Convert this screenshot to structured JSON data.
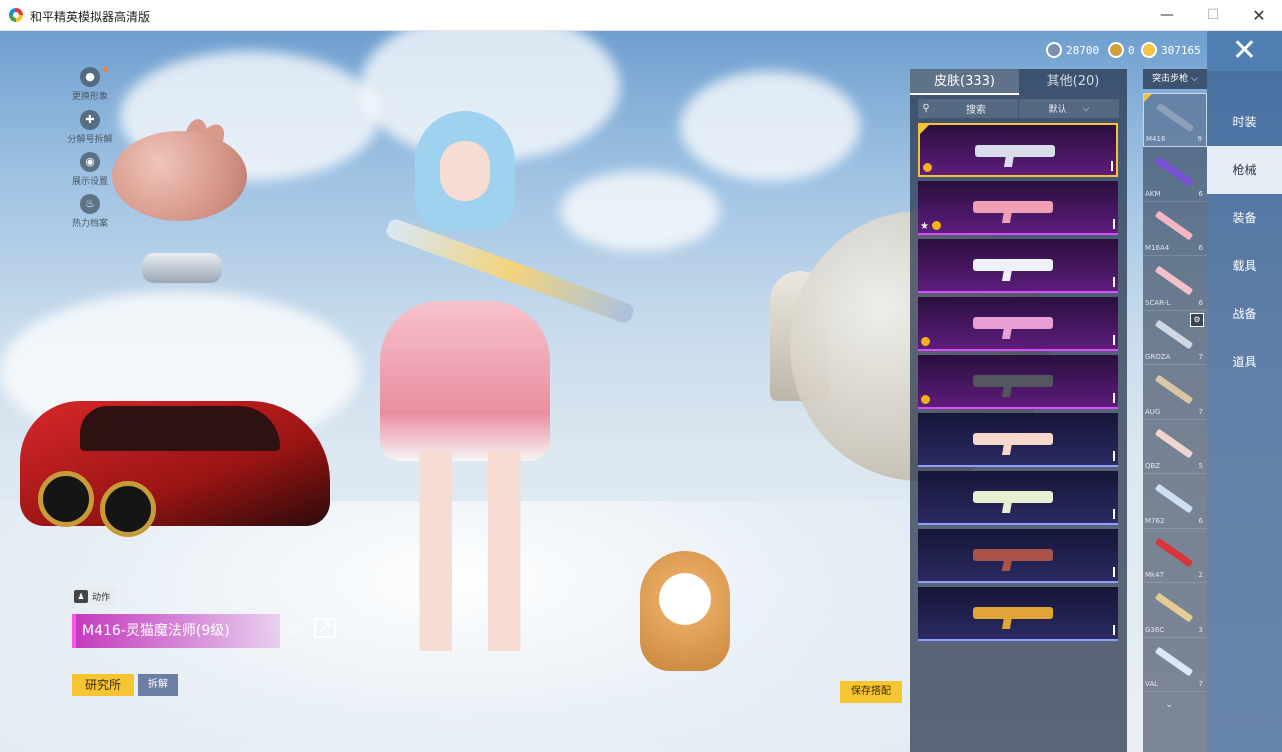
{
  "window": {
    "title": "和平精英模拟器高清版",
    "minimize": "—",
    "maximize": "☐",
    "close": "✕"
  },
  "currencies": [
    {
      "name": "coupon-icon",
      "value": "28700",
      "color": "#7c8fb0"
    },
    {
      "name": "token-icon",
      "value": "0",
      "color": "#d1a23a"
    },
    {
      "name": "gold-coin-icon",
      "value": "307165",
      "color": "#f2c54a"
    }
  ],
  "close_button": "✕",
  "left_menu": [
    {
      "icon": "avatar-icon",
      "label": "更换形象",
      "has_dot": true
    },
    {
      "icon": "share-puzzle-icon",
      "label": "分解号拆解",
      "has_dot": false
    },
    {
      "icon": "eye-icon",
      "label": "展示设置",
      "has_dot": false
    },
    {
      "icon": "flame-icon",
      "label": "热力档案",
      "has_dot": false
    }
  ],
  "weapon_info": {
    "action_label": "动作",
    "skin_name": "M416-灵猫魔法师(9级)",
    "research_button": "研究所",
    "disassemble_button": "拆解",
    "save_button": "保存搭配"
  },
  "skin_panel": {
    "tab_skin": "皮肤(333)",
    "tab_other": "其他(20)",
    "search_placeholder": "搜索",
    "sort_label": "默认",
    "cards": [
      {
        "style": "pink",
        "gun_color": "#d8dde9",
        "selected": true,
        "badge": "gold",
        "star": false
      },
      {
        "style": "pink",
        "gun_color": "#f19fb4",
        "selected": false,
        "badge": "gold",
        "star": true
      },
      {
        "style": "pink",
        "gun_color": "#eef2f8",
        "selected": false,
        "badge": "",
        "star": false
      },
      {
        "style": "pink",
        "gun_color": "#e79fd6",
        "selected": false,
        "badge": "gold",
        "star": false
      },
      {
        "style": "pink",
        "gun_color": "#55575e",
        "selected": false,
        "badge": "gold",
        "star": false
      },
      {
        "style": "blue",
        "gun_color": "#f5d8cb",
        "selected": false,
        "badge": "",
        "star": false
      },
      {
        "style": "blue",
        "gun_color": "#e8efd3",
        "selected": false,
        "badge": "",
        "star": false
      },
      {
        "style": "blue",
        "gun_color": "#a9534a",
        "selected": false,
        "badge": "",
        "star": false
      },
      {
        "style": "blue",
        "gun_color": "#e2a436",
        "selected": false,
        "badge": "",
        "star": false
      }
    ]
  },
  "weapon_filter": "突击步枪",
  "weapons": [
    {
      "name": "M416",
      "count": "9",
      "color": "#8e9fb8",
      "active": true,
      "badge": ""
    },
    {
      "name": "AKM",
      "count": "6",
      "color": "#7a4fd8",
      "active": false,
      "badge": ""
    },
    {
      "name": "M16A4",
      "count": "6",
      "color": "#f3b7c2",
      "active": false,
      "badge": ""
    },
    {
      "name": "SCAR-L",
      "count": "6",
      "color": "#f2c0cb",
      "active": false,
      "badge": ""
    },
    {
      "name": "GROZA",
      "count": "7",
      "color": "#cfd8e3",
      "active": false,
      "badge": "⚙"
    },
    {
      "name": "AUG",
      "count": "7",
      "color": "#d8c6a4",
      "active": false,
      "badge": ""
    },
    {
      "name": "QBZ",
      "count": "5",
      "color": "#f1d6d0",
      "active": false,
      "badge": ""
    },
    {
      "name": "M762",
      "count": "6",
      "color": "#cfe0f4",
      "active": false,
      "badge": ""
    },
    {
      "name": "Mk47",
      "count": "2",
      "color": "#d8343a",
      "active": false,
      "badge": ""
    },
    {
      "name": "G36C",
      "count": "3",
      "color": "#e6cc94",
      "active": false,
      "badge": ""
    },
    {
      "name": "VAL",
      "count": "7",
      "color": "#dbe7f3",
      "active": false,
      "badge": ""
    }
  ],
  "categories": [
    {
      "label": "时装",
      "active": false
    },
    {
      "label": "枪械",
      "active": true
    },
    {
      "label": "装备",
      "active": false
    },
    {
      "label": "载具",
      "active": false
    },
    {
      "label": "战备",
      "active": false
    },
    {
      "label": "道具",
      "active": false
    }
  ]
}
